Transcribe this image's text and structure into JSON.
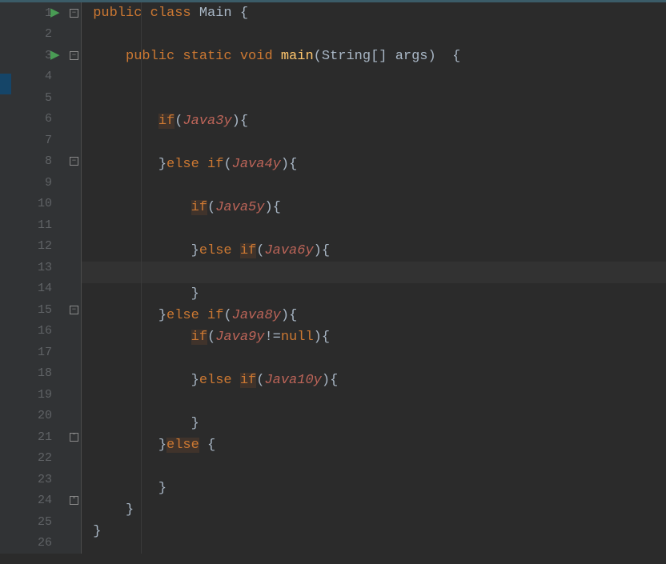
{
  "totalLines": 26,
  "activeLine": 13,
  "runMarkers": [
    1,
    3
  ],
  "foldMarkers": {
    "1": "minus",
    "3": "minus",
    "8": "minus",
    "15": "minus",
    "21": "up",
    "24": "up"
  },
  "code": {
    "l1": [
      {
        "t": " ",
        "c": ""
      },
      {
        "t": "public class ",
        "c": "kw"
      },
      {
        "t": "Main ",
        "c": "cls"
      },
      {
        "t": "{",
        "c": "punct"
      }
    ],
    "l2": [],
    "l3": [
      {
        "t": "     ",
        "c": ""
      },
      {
        "t": "public static void ",
        "c": "kw"
      },
      {
        "t": "main",
        "c": "method"
      },
      {
        "t": "(String[] args)  {",
        "c": "punct"
      }
    ],
    "l4": [],
    "l5": [],
    "l6": [
      {
        "t": "         ",
        "c": ""
      },
      {
        "t": "if",
        "c": "kw-hl"
      },
      {
        "t": "(",
        "c": "punct"
      },
      {
        "t": "Java3y",
        "c": "ident"
      },
      {
        "t": "){",
        "c": "punct"
      }
    ],
    "l7": [],
    "l8": [
      {
        "t": "         }",
        "c": "punct"
      },
      {
        "t": "else if",
        "c": "kw"
      },
      {
        "t": "(",
        "c": "punct"
      },
      {
        "t": "Java4y",
        "c": "ident"
      },
      {
        "t": "){",
        "c": "punct"
      }
    ],
    "l9": [],
    "l10": [
      {
        "t": "             ",
        "c": ""
      },
      {
        "t": "if",
        "c": "kw-hl"
      },
      {
        "t": "(",
        "c": "punct"
      },
      {
        "t": "Java5y",
        "c": "ident"
      },
      {
        "t": "){",
        "c": "punct"
      }
    ],
    "l11": [],
    "l12": [
      {
        "t": "             }",
        "c": "punct"
      },
      {
        "t": "else ",
        "c": "kw"
      },
      {
        "t": "if",
        "c": "kw-hl"
      },
      {
        "t": "(",
        "c": "punct"
      },
      {
        "t": "Java6y",
        "c": "ident"
      },
      {
        "t": "){",
        "c": "punct"
      }
    ],
    "l13": [],
    "l14": [
      {
        "t": "             }",
        "c": "punct"
      }
    ],
    "l15": [
      {
        "t": "         }",
        "c": "punct"
      },
      {
        "t": "else if",
        "c": "kw"
      },
      {
        "t": "(",
        "c": "punct"
      },
      {
        "t": "Java8y",
        "c": "ident"
      },
      {
        "t": "){",
        "c": "punct"
      }
    ],
    "l16": [
      {
        "t": "             ",
        "c": ""
      },
      {
        "t": "if",
        "c": "kw-hl"
      },
      {
        "t": "(",
        "c": "punct"
      },
      {
        "t": "Java9y",
        "c": "ident"
      },
      {
        "t": "!=",
        "c": "punct"
      },
      {
        "t": "null",
        "c": "kw"
      },
      {
        "t": "){",
        "c": "punct"
      }
    ],
    "l17": [],
    "l18": [
      {
        "t": "             }",
        "c": "punct"
      },
      {
        "t": "else ",
        "c": "kw"
      },
      {
        "t": "if",
        "c": "kw-hl"
      },
      {
        "t": "(",
        "c": "punct"
      },
      {
        "t": "Java10y",
        "c": "ident"
      },
      {
        "t": "){",
        "c": "punct"
      }
    ],
    "l19": [],
    "l20": [
      {
        "t": "             }",
        "c": "punct"
      }
    ],
    "l21": [
      {
        "t": "         }",
        "c": "punct"
      },
      {
        "t": "else",
        "c": "kw-hl"
      },
      {
        "t": " {",
        "c": "punct"
      }
    ],
    "l22": [],
    "l23": [
      {
        "t": "         }",
        "c": "punct"
      }
    ],
    "l24": [
      {
        "t": "     }",
        "c": "punct"
      }
    ],
    "l25": [
      {
        "t": " }",
        "c": "punct"
      }
    ],
    "l26": []
  }
}
